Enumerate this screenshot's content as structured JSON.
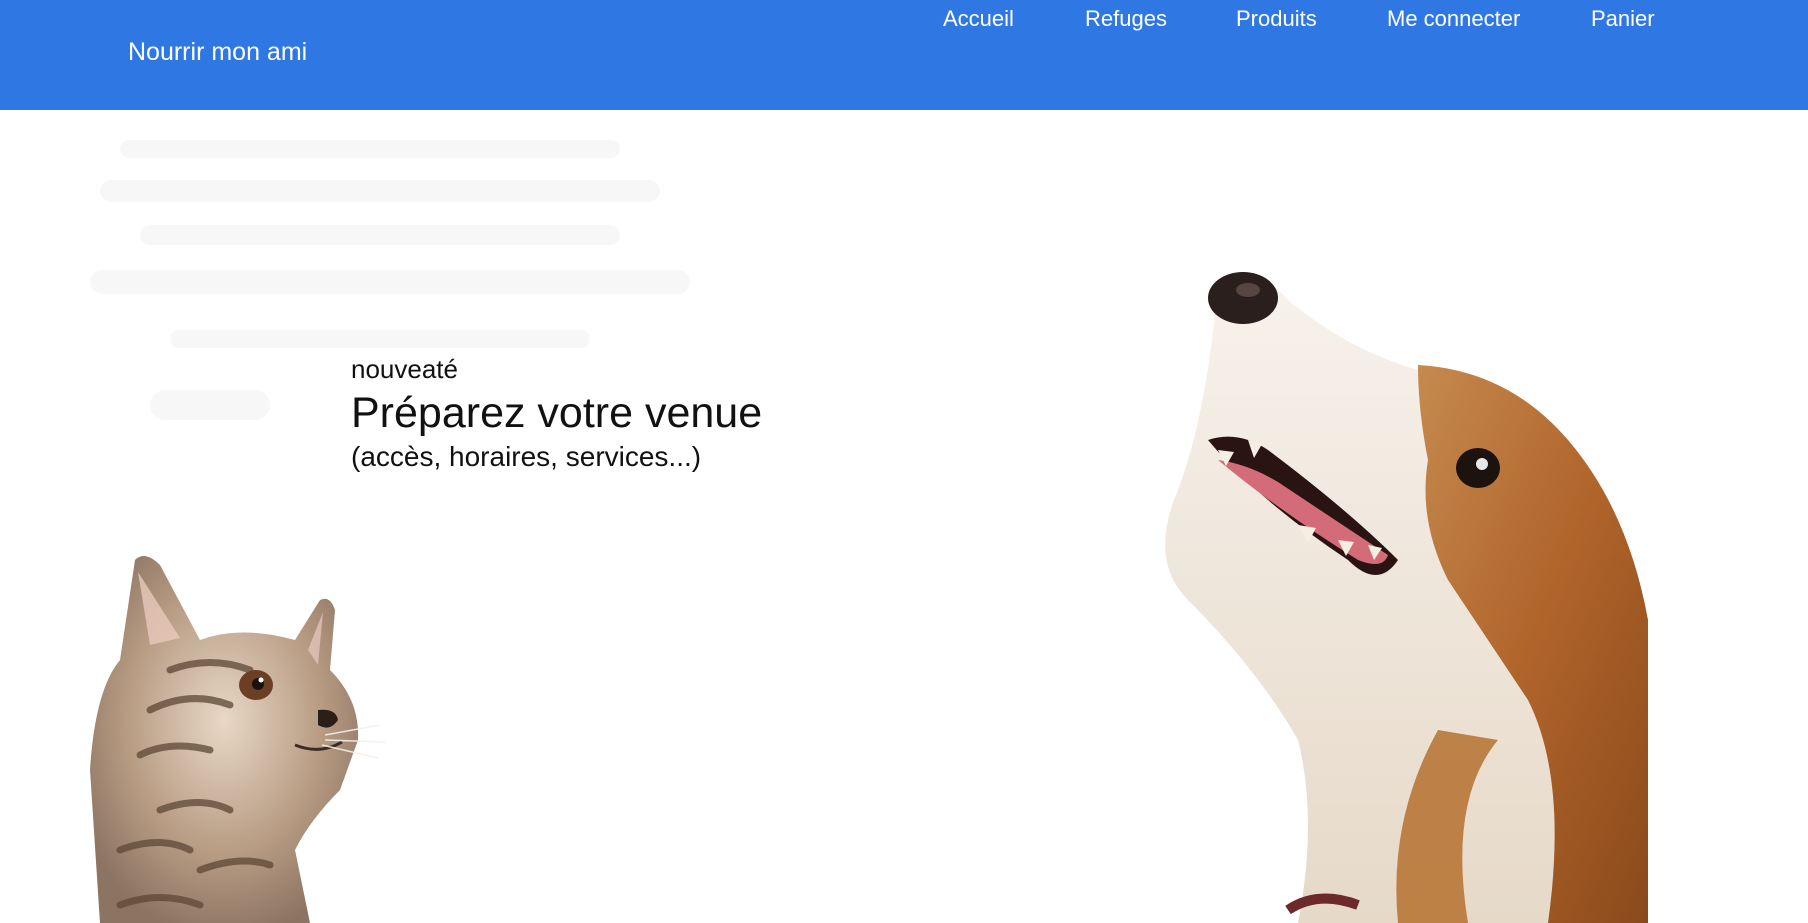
{
  "navbar": {
    "brand": "Nourrir mon ami",
    "background_color": "#2f78e4",
    "links": [
      {
        "label": "Accueil"
      },
      {
        "label": "Refuges"
      },
      {
        "label": "Produits"
      },
      {
        "label": "Me connecter"
      },
      {
        "label": "Panier"
      }
    ]
  },
  "hero": {
    "eyebrow": "nouveaté",
    "headline": "Préparez votre venue",
    "subline": "(accès, horaires, services...)",
    "images": {
      "left": "kitten-photo",
      "right": "dog-photo"
    }
  }
}
